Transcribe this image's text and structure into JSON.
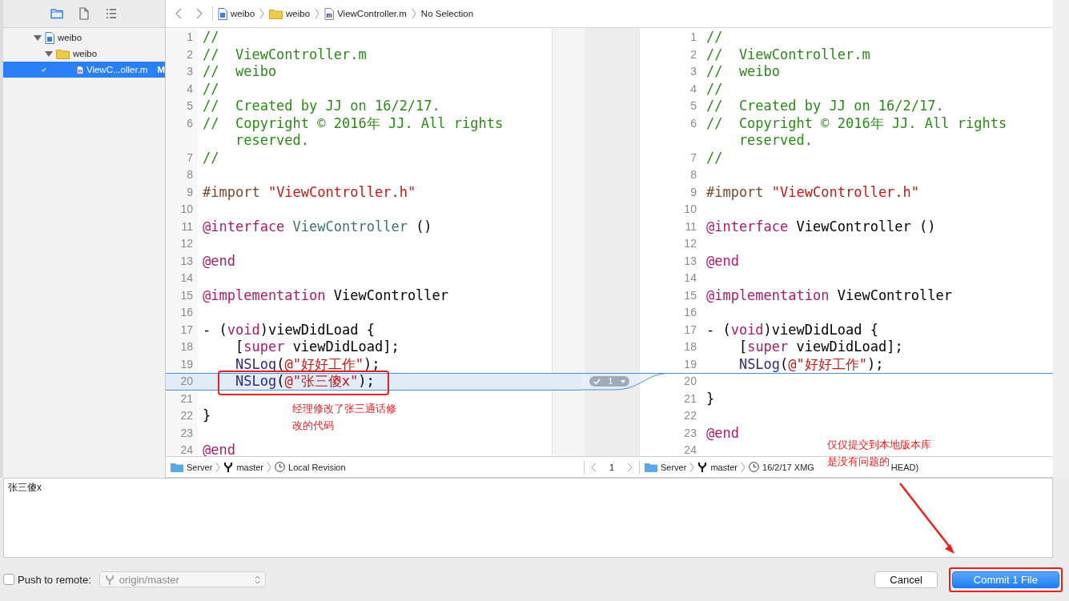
{
  "navigator_tabs": [
    {
      "kind": "folder",
      "selected": true
    },
    {
      "kind": "file",
      "selected": false
    },
    {
      "kind": "list",
      "selected": false
    }
  ],
  "tree": [
    {
      "kind": "project",
      "label": "weibo",
      "expanded": true,
      "children": [
        {
          "kind": "folder",
          "label": "weibo",
          "expanded": true,
          "children": [
            {
              "kind": "source",
              "label": "ViewC...oller.m",
              "status": "M",
              "checked": true,
              "selected": true
            }
          ]
        }
      ]
    }
  ],
  "breadcrumb": [
    {
      "kind": "project",
      "label": "weibo"
    },
    {
      "kind": "folder",
      "label": "weibo"
    },
    {
      "kind": "source",
      "label": "ViewController.m"
    },
    {
      "kind": "plain",
      "label": "No Selection"
    }
  ],
  "left_pane": {
    "lines": [
      {
        "n": "1",
        "changed": false,
        "tokens": [
          {
            "kind": "comment",
            "text": "//"
          }
        ]
      },
      {
        "n": "2",
        "changed": false,
        "tokens": [
          {
            "kind": "comment",
            "text": "//  ViewController.m"
          }
        ]
      },
      {
        "n": "3",
        "changed": false,
        "tokens": [
          {
            "kind": "comment",
            "text": "//  weibo"
          }
        ]
      },
      {
        "n": "4",
        "changed": false,
        "tokens": [
          {
            "kind": "comment",
            "text": "//"
          }
        ]
      },
      {
        "n": "5",
        "changed": false,
        "tokens": [
          {
            "kind": "comment",
            "text": "//  Created by JJ on 16/2/17."
          }
        ]
      },
      {
        "n": "6",
        "changed": false,
        "tokens": [
          {
            "kind": "comment",
            "text": "//  Copyright © 2016年 JJ. All rights reserved."
          }
        ]
      },
      {
        "n": "7",
        "changed": false,
        "tokens": [
          {
            "kind": "comment",
            "text": "//"
          }
        ]
      },
      {
        "n": "8",
        "changed": false
      },
      {
        "n": "9",
        "changed": false,
        "tokens": [
          {
            "kind": "directive",
            "text": "#import "
          },
          {
            "kind": "string",
            "text": "\"ViewController.h\""
          }
        ]
      },
      {
        "n": "10",
        "changed": false
      },
      {
        "n": "11",
        "changed": false,
        "tokens": [
          {
            "kind": "keyword",
            "text": "@interface "
          },
          {
            "kind": "type",
            "text": "ViewController"
          },
          {
            "kind": "plain",
            "text": " ()"
          }
        ]
      },
      {
        "n": "12",
        "changed": false
      },
      {
        "n": "13",
        "changed": false,
        "tokens": [
          {
            "kind": "keyword",
            "text": "@end"
          }
        ]
      },
      {
        "n": "14",
        "changed": false
      },
      {
        "n": "15",
        "changed": false,
        "tokens": [
          {
            "kind": "keyword",
            "text": "@implementation"
          },
          {
            "kind": "plain",
            "text": " ViewController"
          }
        ]
      },
      {
        "n": "16",
        "changed": false
      },
      {
        "n": "17",
        "changed": false,
        "tokens": [
          {
            "kind": "plain",
            "text": "- ("
          },
          {
            "kind": "keyword",
            "text": "void"
          },
          {
            "kind": "plain",
            "text": ")viewDidLoad {"
          }
        ]
      },
      {
        "n": "18",
        "changed": false,
        "tokens": [
          {
            "kind": "plain",
            "text": "    ["
          },
          {
            "kind": "keyword",
            "text": "super"
          },
          {
            "kind": "plain",
            "text": " viewDidLoad];"
          }
        ]
      },
      {
        "n": "19",
        "changed": false,
        "tokens": [
          {
            "kind": "func",
            "text": "    NSLog"
          },
          {
            "kind": "plain",
            "text": "("
          },
          {
            "kind": "string",
            "text": "@\"好好工作\""
          },
          {
            "kind": "plain",
            "text": ");"
          }
        ]
      },
      {
        "n": "20",
        "changed": true,
        "boxed": true,
        "tokens": [
          {
            "kind": "func",
            "text": "    NSLog"
          },
          {
            "kind": "plain",
            "text": "("
          },
          {
            "kind": "string",
            "text": "@\"张三傻x\""
          },
          {
            "kind": "plain",
            "text": ");"
          }
        ]
      },
      {
        "n": "21",
        "changed": false
      },
      {
        "n": "22",
        "changed": false,
        "tokens": [
          {
            "kind": "plain",
            "text": "}"
          }
        ]
      },
      {
        "n": "23",
        "changed": false
      },
      {
        "n": "24",
        "changed": false,
        "tokens": [
          {
            "kind": "keyword",
            "text": "@end"
          }
        ]
      }
    ],
    "status": [
      {
        "kind": "server",
        "label": "Server"
      },
      {
        "kind": "branch",
        "label": "master"
      },
      {
        "kind": "revision",
        "label": "Local Revision"
      }
    ]
  },
  "diff_nav": {
    "current": "1"
  },
  "change_badge": {
    "count": "1"
  },
  "right_pane": {
    "lines": [
      {
        "n": "1",
        "changed": false,
        "tokens": [
          {
            "kind": "comment",
            "text": "//"
          }
        ]
      },
      {
        "n": "2",
        "changed": false,
        "tokens": [
          {
            "kind": "comment",
            "text": "//  ViewController.m"
          }
        ]
      },
      {
        "n": "3",
        "changed": false,
        "tokens": [
          {
            "kind": "comment",
            "text": "//  weibo"
          }
        ]
      },
      {
        "n": "4",
        "changed": false,
        "tokens": [
          {
            "kind": "comment",
            "text": "//"
          }
        ]
      },
      {
        "n": "5",
        "changed": false,
        "tokens": [
          {
            "kind": "comment",
            "text": "//  Created by JJ on 16/2/17."
          }
        ]
      },
      {
        "n": "6",
        "changed": false,
        "tokens": [
          {
            "kind": "comment",
            "text": "//  Copyright © 2016年 JJ. All rights reserved."
          }
        ]
      },
      {
        "n": "7",
        "changed": false,
        "tokens": [
          {
            "kind": "comment",
            "text": "//"
          }
        ]
      },
      {
        "n": "8",
        "changed": false
      },
      {
        "n": "9",
        "changed": false,
        "tokens": [
          {
            "kind": "directive",
            "text": "#import "
          },
          {
            "kind": "string",
            "text": "\"ViewController.h\""
          }
        ]
      },
      {
        "n": "10",
        "changed": false
      },
      {
        "n": "11",
        "changed": false,
        "tokens": [
          {
            "kind": "keyword",
            "text": "@interface"
          },
          {
            "kind": "plain",
            "text": " ViewController ()"
          }
        ]
      },
      {
        "n": "12",
        "changed": false
      },
      {
        "n": "13",
        "changed": false,
        "tokens": [
          {
            "kind": "keyword",
            "text": "@end"
          }
        ]
      },
      {
        "n": "14",
        "changed": false
      },
      {
        "n": "15",
        "changed": false,
        "tokens": [
          {
            "kind": "keyword",
            "text": "@implementation"
          },
          {
            "kind": "plain",
            "text": " ViewController"
          }
        ]
      },
      {
        "n": "16",
        "changed": false
      },
      {
        "n": "17",
        "changed": false,
        "tokens": [
          {
            "kind": "plain",
            "text": "- ("
          },
          {
            "kind": "keyword",
            "text": "void"
          },
          {
            "kind": "plain",
            "text": ")viewDidLoad {"
          }
        ]
      },
      {
        "n": "18",
        "changed": false,
        "tokens": [
          {
            "kind": "plain",
            "text": "    ["
          },
          {
            "kind": "keyword",
            "text": "super"
          },
          {
            "kind": "plain",
            "text": " viewDidLoad];"
          }
        ]
      },
      {
        "n": "19",
        "changed": false,
        "tokens": [
          {
            "kind": "func",
            "text": "    NSLog"
          },
          {
            "kind": "plain",
            "text": "("
          },
          {
            "kind": "string",
            "text": "@\"好好工作\""
          },
          {
            "kind": "plain",
            "text": ");"
          }
        ]
      },
      {
        "n": "20",
        "changed": true
      },
      {
        "n": "21",
        "changed": false,
        "tokens": [
          {
            "kind": "plain",
            "text": "}"
          }
        ]
      },
      {
        "n": "22",
        "changed": false
      },
      {
        "n": "23",
        "changed": false,
        "tokens": [
          {
            "kind": "keyword",
            "text": "@end"
          }
        ]
      },
      {
        "n": "24",
        "changed": false
      }
    ],
    "status": [
      {
        "kind": "server",
        "label": "Server"
      },
      {
        "kind": "branch",
        "label": "master"
      },
      {
        "kind": "revision",
        "label": "16/2/17  XMG"
      },
      {
        "kind": "tail",
        "label": "HEAD)"
      }
    ]
  },
  "commit_message": "张三傻x",
  "push": {
    "label": "Push to remote:",
    "checked": false,
    "remote": "origin/master",
    "disabled": true
  },
  "buttons": [
    {
      "label": "Cancel",
      "kind": "default",
      "boxed": false
    },
    {
      "label": "Commit 1 File",
      "kind": "primary",
      "boxed": true
    }
  ],
  "annotations": [
    {
      "kind": "code-note",
      "lines": [
        "经理修改了张三通话修",
        "改的代码"
      ]
    },
    {
      "kind": "commit-note",
      "lines": [
        "仅仅提交到本地版本库",
        "是没有问题的"
      ],
      "arrow": true
    }
  ]
}
